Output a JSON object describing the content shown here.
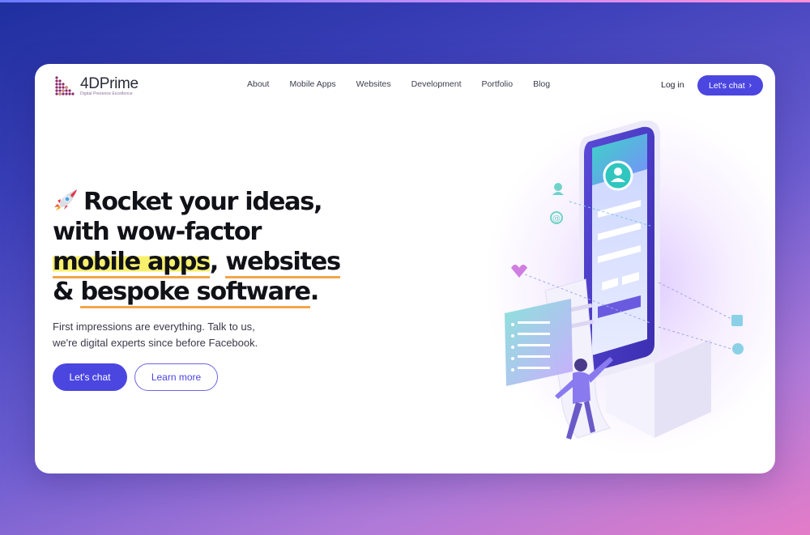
{
  "brand": {
    "name_prefix": "4D",
    "name_suffix": "Prime",
    "tagline": "Digital Presence Excellence"
  },
  "nav": {
    "items": [
      "About",
      "Mobile Apps",
      "Websites",
      "Development",
      "Portfolio",
      "Blog"
    ],
    "login": "Log in",
    "cta": "Let's chat",
    "cta_icon": "chevron-right-icon"
  },
  "hero": {
    "line1": "Rocket your ideas,",
    "line2": "with wow-factor",
    "line3_highlight": "mobile apps",
    "line3_sep": ",",
    "line3_rest": "websites",
    "line4_prefix": "&",
    "line4_highlight": "bespoke software",
    "line4_end": ".",
    "icon": "rocket-icon",
    "subtitle_line1": "First impressions are everything. Talk to us,",
    "subtitle_line2": "we're digital experts since before Facebook.",
    "primary_button": "Let's chat",
    "secondary_button": "Learn more"
  },
  "colors": {
    "accent": "#4b46e0",
    "highlight_yellow": "#f7f06a",
    "underline_orange": "#f3a64a"
  }
}
